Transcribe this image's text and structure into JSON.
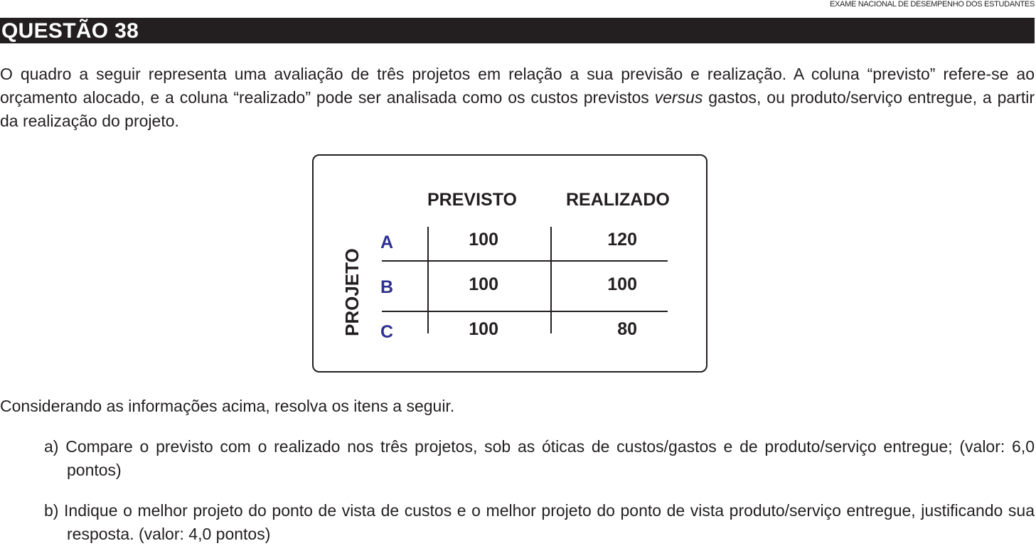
{
  "header": {
    "exam_name": "EXAME NACIONAL DE DESEMPENHO DOS ESTUDANTES"
  },
  "question": {
    "title": "QUESTÃO 38"
  },
  "intro": {
    "part1": "O quadro a seguir representa uma avaliação de três projetos em relação a sua previsão e realização. A coluna “previsto” refere-se ao orçamento alocado, e a coluna “realizado” pode ser analisada como os custos previstos ",
    "emphasis": "versus",
    "part2": " gastos, ou produto/serviço entregue, a partir da realização do projeto."
  },
  "table": {
    "row_axis_label": "PROJETO",
    "columns": [
      "PREVISTO",
      "REALIZADO"
    ],
    "rows": [
      {
        "label": "A",
        "previsto": "100",
        "realizado": "120"
      },
      {
        "label": "B",
        "previsto": "100",
        "realizado": "100"
      },
      {
        "label": "C",
        "previsto": "100",
        "realizado": "80"
      }
    ]
  },
  "instructions": "Considerando as informações acima, resolva os itens a seguir.",
  "items": [
    {
      "text": "a) Compare o previsto com o realizado nos três projetos, sob as óticas de custos/gastos e de produto/serviço entregue; (valor: 6,0 pontos)"
    },
    {
      "text": "b) Indique o melhor projeto do ponto de vista de custos e o melhor projeto do ponto de vista produto/serviço entregue, justificando sua resposta. (valor: 4,0 pontos)"
    }
  ]
}
